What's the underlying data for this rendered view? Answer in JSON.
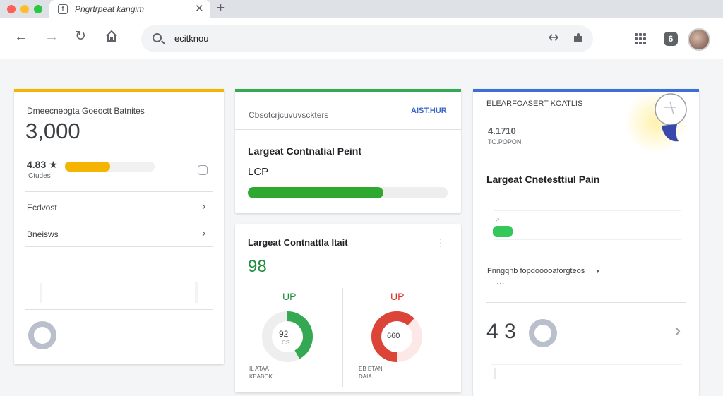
{
  "browser": {
    "tab_title": "Pngrtrpeat kangim",
    "tab_favicon": "f",
    "close_label": "✕",
    "new_tab_label": "+",
    "address": "ecitknou",
    "extension_badge": "6"
  },
  "cards": {
    "left": {
      "title": "Dmeecneogta Goeoctt Batnites",
      "big_value": "3,000",
      "metric_value": "4.83 ★",
      "metric_sub": "Ctudes",
      "progress": 0.5,
      "row1": "Ecdvost",
      "row2": "Bneisws",
      "chevron": "›"
    },
    "middle_top": {
      "header": "Cbsotcrjcuvuvsckters",
      "header_link": "AIST.HUR",
      "title": "Largeat Contnatial Peint",
      "subtitle": "LCP",
      "progress": 0.68
    },
    "middle_bottom": {
      "title": "Largeat Contnattla Itait",
      "value": "98",
      "left_label": "UP",
      "left_donut_value": "92",
      "left_donut_sub": "CS",
      "left_donut_fraction": 0.42,
      "left_caption_1": "IL ATAA",
      "left_caption_2": "KEABOK",
      "right_label": "UP",
      "right_donut_value": "660",
      "right_donut_fraction": 0.62,
      "right_caption_1": "EB ETAN",
      "right_caption_2": "DAIA"
    },
    "right": {
      "header": "ELEARFOASERT KOATLIS",
      "value": "4.1710",
      "sub": "TO.POPON",
      "title": "Largeat Cnetesttiul Pain",
      "progress": 0.12,
      "filter_label": "Fnngqnb fopdooooaforgteos",
      "dots": "• • •",
      "big_number": "4 3",
      "chevron": "›"
    }
  },
  "colors": {
    "yellow": "#f4b400",
    "green": "#34a853",
    "blue": "#4285f4",
    "red": "#db4437",
    "grey_ring": "#b9c0cb"
  }
}
